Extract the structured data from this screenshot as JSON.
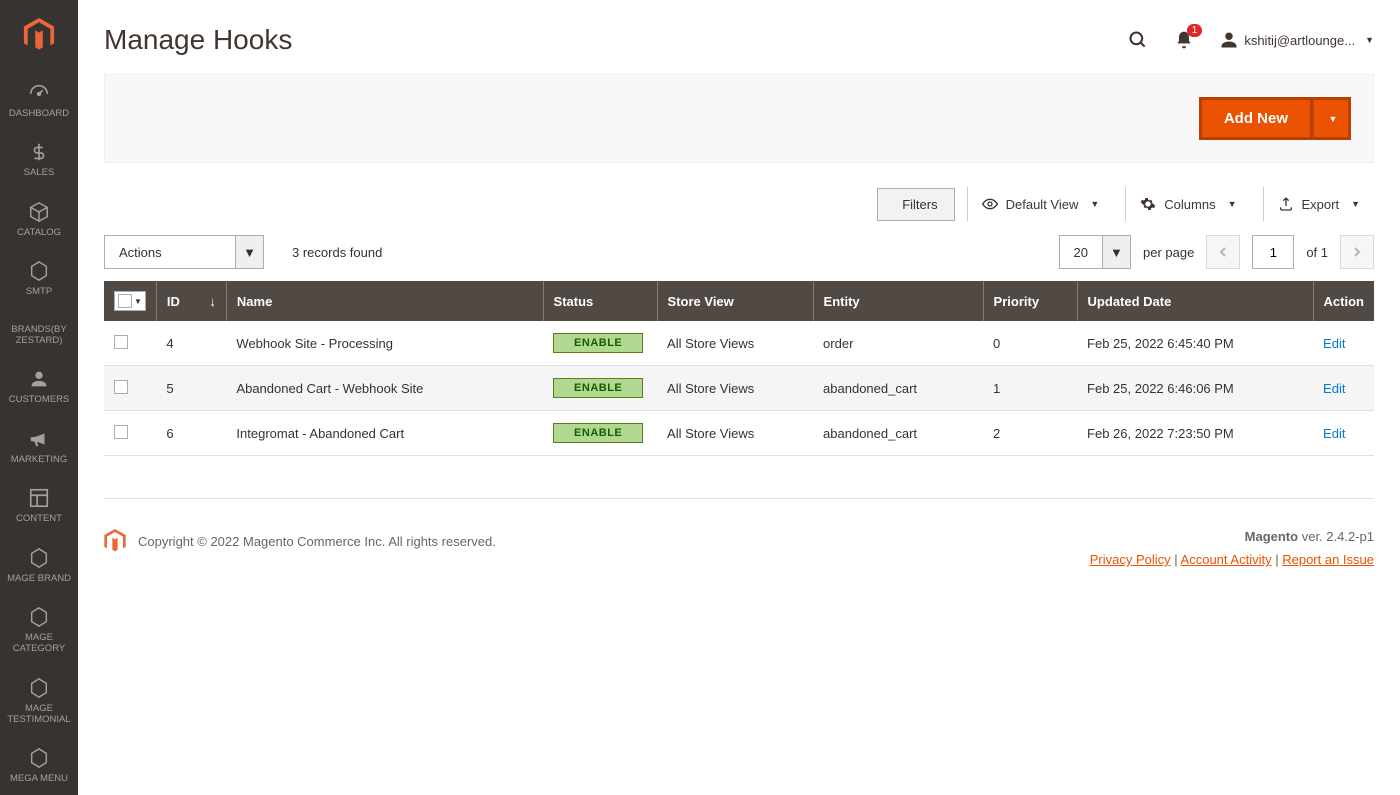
{
  "sidebar": {
    "items": [
      {
        "label": "DASHBOARD",
        "icon": "gauge"
      },
      {
        "label": "SALES",
        "icon": "dollar"
      },
      {
        "label": "CATALOG",
        "icon": "cube"
      },
      {
        "label": "SMTP",
        "icon": "hex"
      },
      {
        "label": "BRANDS(BY ZESTARD)",
        "icon": "none"
      },
      {
        "label": "CUSTOMERS",
        "icon": "person"
      },
      {
        "label": "MARKETING",
        "icon": "megaphone"
      },
      {
        "label": "CONTENT",
        "icon": "layout"
      },
      {
        "label": "MAGE BRAND",
        "icon": "hex"
      },
      {
        "label": "MAGE CATEGORY",
        "icon": "hex"
      },
      {
        "label": "MAGE TESTIMONIAL",
        "icon": "hex"
      },
      {
        "label": "MEGA MENU",
        "icon": "hex"
      }
    ]
  },
  "header": {
    "title": "Manage Hooks",
    "notification_count": "1",
    "username": "kshitij@artlounge...",
    "add_new_label": "Add New"
  },
  "toolbar": {
    "filters_label": "Filters",
    "view_label": "Default View",
    "columns_label": "Columns",
    "export_label": "Export"
  },
  "controls": {
    "actions_label": "Actions",
    "records_found": "3 records found",
    "page_size": "20",
    "per_page_label": "per page",
    "current_page": "1",
    "of_label": "of 1"
  },
  "table": {
    "headers": {
      "id": "ID",
      "name": "Name",
      "status": "Status",
      "store_view": "Store View",
      "entity": "Entity",
      "priority": "Priority",
      "updated": "Updated Date",
      "action": "Action"
    },
    "rows": [
      {
        "id": "4",
        "name": "Webhook Site - Processing",
        "status": "ENABLE",
        "store_view": "All Store Views",
        "entity": "order",
        "priority": "0",
        "updated": "Feb 25, 2022 6:45:40 PM",
        "action": "Edit"
      },
      {
        "id": "5",
        "name": "Abandoned Cart - Webhook Site",
        "status": "ENABLE",
        "store_view": "All Store Views",
        "entity": "abandoned_cart",
        "priority": "1",
        "updated": "Feb 25, 2022 6:46:06 PM",
        "action": "Edit"
      },
      {
        "id": "6",
        "name": "Integromat - Abandoned Cart",
        "status": "ENABLE",
        "store_view": "All Store Views",
        "entity": "abandoned_cart",
        "priority": "2",
        "updated": "Feb 26, 2022 7:23:50 PM",
        "action": "Edit"
      }
    ]
  },
  "footer": {
    "copyright": "Copyright © 2022 Magento Commerce Inc. All rights reserved.",
    "product": "Magento",
    "version": "ver. 2.4.2-p1",
    "links": {
      "privacy": "Privacy Policy",
      "activity": "Account Activity",
      "report": "Report an Issue"
    }
  }
}
